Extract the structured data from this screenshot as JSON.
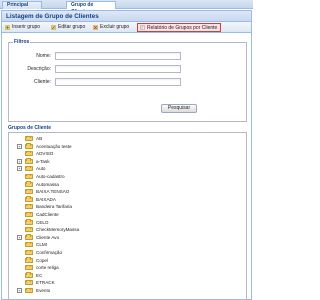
{
  "tabs": [
    {
      "label": "Principal",
      "active": false
    },
    {
      "label": "Grupo de Cliente",
      "active": true
    }
  ],
  "page": {
    "title": "Listagem de Grupo de Clientes"
  },
  "toolbar": {
    "insert": "Inserir grupo",
    "edit": "Editar grupo",
    "delete": "Excluir grupo",
    "report": "Relatório de Grupos por Cliente"
  },
  "filters": {
    "legend": "Filtros",
    "nome_label": "Nome:",
    "nome_value": "",
    "descricao_label": "Descrição:",
    "descricao_value": "",
    "cliente_label": "Cliente:",
    "cliente_value": "",
    "search_button": "Pesquisar"
  },
  "tree": {
    "title": "Grupos de Cliente",
    "items": [
      {
        "label": "AB",
        "expandable": false
      },
      {
        "label": "Acentuação teste",
        "expandable": true
      },
      {
        "label": "ADVISO",
        "expandable": false
      },
      {
        "label": "a-Task",
        "expandable": true
      },
      {
        "label": "Auto",
        "expandable": true
      },
      {
        "label": "Auto-cadastro",
        "expandable": false
      },
      {
        "label": "Automassa",
        "expandable": false
      },
      {
        "label": "BAIXA TENSAO",
        "expandable": false
      },
      {
        "label": "BAIXADA",
        "expandable": false
      },
      {
        "label": "Bandeira Tarifaria",
        "expandable": false
      },
      {
        "label": "CadCliente",
        "expandable": false
      },
      {
        "label": "CELO",
        "expandable": false
      },
      {
        "label": "CheckMemoryMassa",
        "expandable": false
      },
      {
        "label": "Cliente Avo",
        "expandable": true
      },
      {
        "label": "CLMI",
        "expandable": false
      },
      {
        "label": "Confirmação",
        "expandable": false
      },
      {
        "label": "Copel",
        "expandable": false
      },
      {
        "label": "corte religa",
        "expandable": false
      },
      {
        "label": "EC",
        "expandable": false
      },
      {
        "label": "ETRACK",
        "expandable": false
      },
      {
        "label": "Evento",
        "expandable": true
      }
    ]
  },
  "colors": {
    "header_text": "#15428b",
    "border": "#99bbe8",
    "highlight_border": "#d23b3b"
  }
}
